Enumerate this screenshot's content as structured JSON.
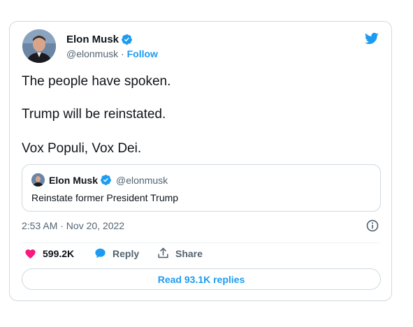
{
  "author": {
    "name": "Elon Musk",
    "handle": "@elonmusk",
    "separator": "·",
    "follow_label": "Follow"
  },
  "tweet": {
    "lines": [
      "The people have spoken.",
      "Trump will be reinstated.",
      "Vox Populi, Vox Dei."
    ]
  },
  "quoted": {
    "name": "Elon Musk",
    "handle": "@elonmusk",
    "text": "Reinstate former President Trump"
  },
  "timestamp": "2:53 AM · Nov 20, 2022",
  "actions": {
    "likes": "599.2K",
    "reply_label": "Reply",
    "share_label": "Share"
  },
  "read_replies_label": "Read 93.1K replies",
  "colors": {
    "accent": "#1d9bf0",
    "like": "#f91880",
    "text": "#0f1419",
    "muted": "#536471",
    "border": "#cfd9de"
  }
}
